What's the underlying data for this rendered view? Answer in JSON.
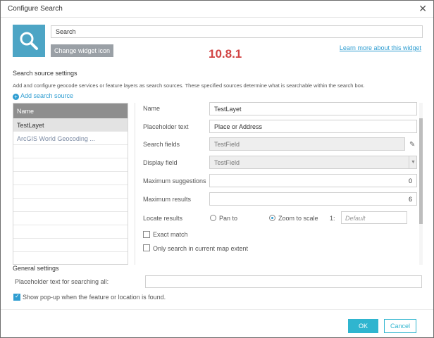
{
  "window": {
    "title": "Configure Search",
    "close": "✕"
  },
  "widget": {
    "name_value": "Search",
    "change_icon_label": "Change widget icon",
    "version": "10.8.1",
    "learn_more": "Learn more about this widget"
  },
  "source_settings": {
    "heading": "Search source settings",
    "description": "Add and configure geocode services or feature layers as search sources. These specified sources determine what is searchable within the search box.",
    "add_label": "Add search source",
    "table_header": "Name",
    "sources": [
      "TestLayet",
      "ArcGIS World Geocoding ..."
    ]
  },
  "form": {
    "name_label": "Name",
    "name_value": "TestLayet",
    "placeholder_label": "Placeholder text",
    "placeholder_value": "Place or Address",
    "search_fields_label": "Search fields",
    "search_fields_value": "TestField",
    "display_field_label": "Display field",
    "display_field_value": "TestField",
    "max_suggestions_label": "Maximum suggestions",
    "max_suggestions_value": "0",
    "max_results_label": "Maximum results",
    "max_results_value": "6",
    "locate_label": "Locate results",
    "pan_to": "Pan to",
    "zoom_to_scale": "Zoom to scale",
    "scale_prefix": "1:",
    "scale_placeholder": "Default",
    "exact_match": "Exact match",
    "only_current_extent": "Only search in current map extent"
  },
  "general": {
    "heading": "General settings",
    "placeholder_all_label": "Placeholder text for searching all:",
    "show_popup_label": "Show pop-up when the feature or location is found."
  },
  "footer": {
    "ok": "OK",
    "cancel": "Cancel"
  },
  "colors": {
    "accent": "#2fb5cf",
    "icon_bg": "#4da5c5",
    "version": "#d24444",
    "link": "#2f9dd1"
  }
}
